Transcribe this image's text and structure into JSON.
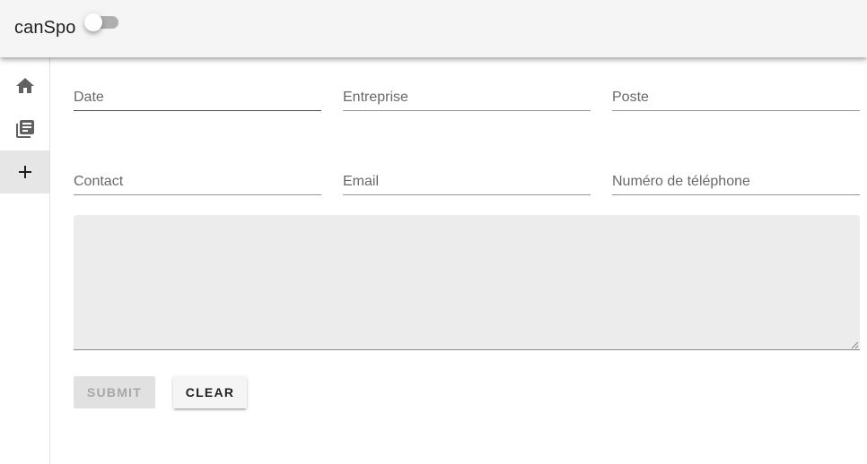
{
  "app_bar": {
    "title": "canSpo",
    "theme_toggle": {
      "checked": false,
      "icon": "toggle-switch"
    }
  },
  "nav": {
    "items": [
      {
        "icon": "home-icon",
        "active": false
      },
      {
        "icon": "library-books-icon",
        "active": false
      },
      {
        "icon": "plus-icon",
        "active": true
      }
    ]
  },
  "form": {
    "fields": {
      "date": {
        "label": "Date",
        "value": ""
      },
      "entreprise": {
        "label": "Entreprise",
        "value": ""
      },
      "poste": {
        "label": "Poste",
        "value": ""
      },
      "contact": {
        "label": "Contact",
        "value": ""
      },
      "email": {
        "label": "Email",
        "value": ""
      },
      "telephone": {
        "label": "Numéro de téléphone",
        "value": ""
      }
    },
    "notes": {
      "value": ""
    },
    "submit_label": "Submit",
    "clear_label": "Clear"
  },
  "colors": {
    "app_bar_bg": "#f5f5f5",
    "nav_active_bg": "#e6e6e6",
    "textarea_bg": "#ececec",
    "icon_color": "#616161"
  }
}
